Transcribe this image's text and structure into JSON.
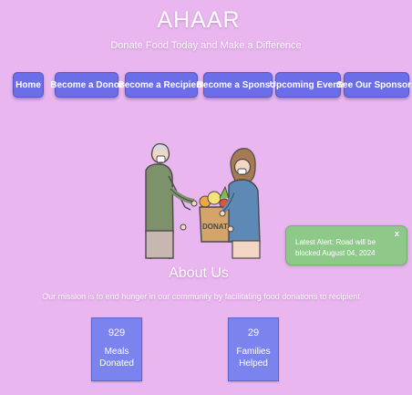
{
  "header": {
    "title": "AHAAR",
    "tagline": "Donate Food Today and Make a Difference"
  },
  "nav": {
    "home": "Home",
    "donor": "Become a Donor",
    "recipient": "Become a Recipient",
    "sponsor": "Become a Sponsor",
    "events": "Upcoming Events",
    "sponsors": "See Our Sponsors"
  },
  "illustration": {
    "box_label": "DONATE"
  },
  "alert": {
    "close": "x",
    "message": "Latest Alert: Road will be blocked August 04, 2024"
  },
  "about": {
    "title": "About Us",
    "mission": "Our mission is to end hunger in our community by facilitating food donations to recipient"
  },
  "stats": [
    {
      "value": "929",
      "label_line1": "Meals",
      "label_line2": "Donated"
    },
    {
      "value": "29",
      "label_line1": "Families",
      "label_line2": "Helped"
    }
  ],
  "colors": {
    "background": "#e9b6ef",
    "nav_button": "#6c6ee8",
    "stat_box": "#7b84ee",
    "alert": "#8ec98a"
  }
}
